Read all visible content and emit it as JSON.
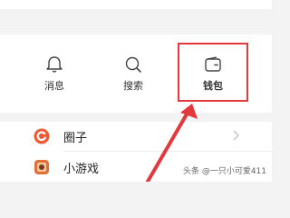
{
  "header": {
    "partial_title": "—— ——"
  },
  "quick_actions": [
    {
      "label": "消息",
      "icon": "bell-icon"
    },
    {
      "label": "搜索",
      "icon": "search-icon"
    },
    {
      "label": "钱包",
      "icon": "wallet-icon"
    }
  ],
  "list": [
    {
      "label": "圈子",
      "icon": "circle-logo-icon",
      "icon_color": "#ef5a35",
      "has_chevron": true
    },
    {
      "label": "小游戏",
      "icon": "game-icon",
      "icon_color": "#e0703a"
    }
  ],
  "annotation": {
    "color": "#e3393c",
    "target": "wallet"
  },
  "watermark": "头条 @一只小可爱411"
}
